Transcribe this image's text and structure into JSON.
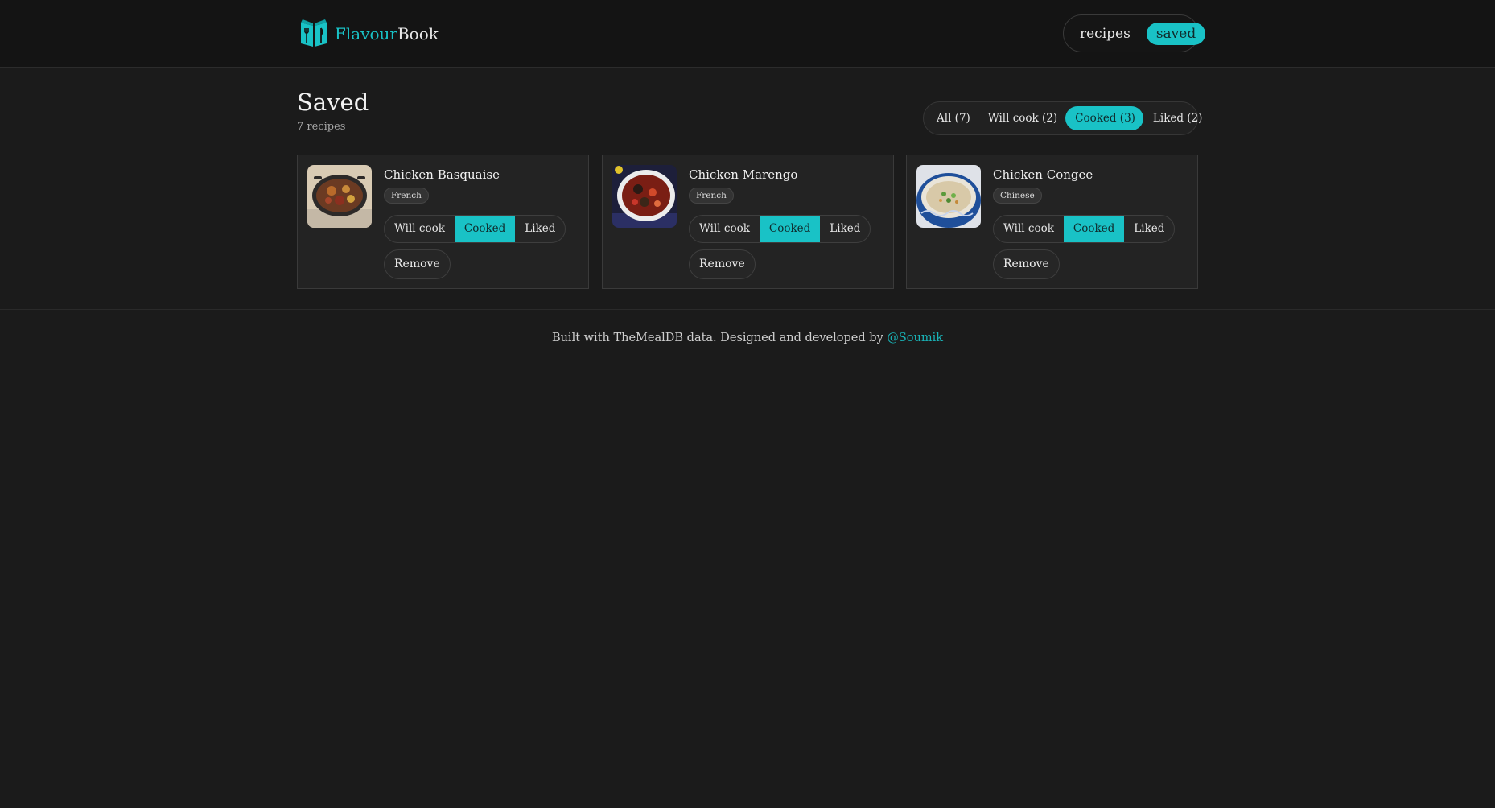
{
  "header": {
    "brand_accent": "Flavour",
    "brand_rest": "Book",
    "logo_icon": "open-book-utensils-icon",
    "nav": [
      {
        "label": "recipes",
        "active": false
      },
      {
        "label": "saved",
        "active": true
      }
    ]
  },
  "page": {
    "title": "Saved",
    "count": "7 recipes",
    "filters": [
      {
        "label": "All (7)",
        "active": false
      },
      {
        "label": "Will cook (2)",
        "active": false
      },
      {
        "label": "Cooked (3)",
        "active": true
      },
      {
        "label": "Liked (2)",
        "active": false
      }
    ]
  },
  "cards": [
    {
      "title": "Chicken Basquaise",
      "tag": "French",
      "status": [
        "Will cook",
        "Cooked",
        "Liked"
      ],
      "selected": "Cooked",
      "remove": "Remove"
    },
    {
      "title": "Chicken Marengo",
      "tag": "French",
      "status": [
        "Will cook",
        "Cooked",
        "Liked"
      ],
      "selected": "Cooked",
      "remove": "Remove"
    },
    {
      "title": "Chicken Congee",
      "tag": "Chinese",
      "status": [
        "Will cook",
        "Cooked",
        "Liked"
      ],
      "selected": "Cooked",
      "remove": "Remove"
    }
  ],
  "footer": {
    "text": "Built with TheMealDB data. Designed and developed by ",
    "link": "@Soumik"
  },
  "colors": {
    "accent": "#19c2c6",
    "background": "#1b1b1b",
    "header": "#141414"
  }
}
